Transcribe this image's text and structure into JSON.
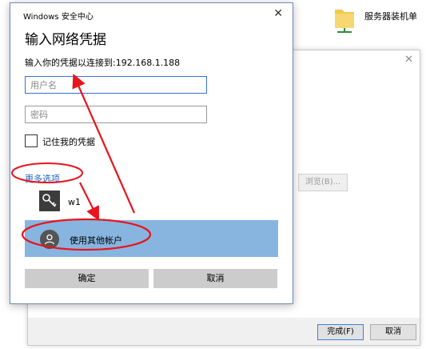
{
  "background": {
    "folder_label": "服务器装机单",
    "browse_label": "浏览(B)...",
    "finish_label": "完成(F)",
    "cancel_label": "取消",
    "close_glyph": "✕"
  },
  "dialog": {
    "caption": "Windows 安全中心",
    "close_glyph": "✕",
    "heading": "输入网络凭据",
    "prompt": "输入你的凭据以连接到:192.168.1.188",
    "username_placeholder": "用户名",
    "password_placeholder": "密码",
    "remember_label": "记住我的凭据",
    "more_options": "更多选项",
    "accounts": [
      {
        "label": "w1",
        "icon": "key-icon"
      },
      {
        "label": "使用其他帐户",
        "icon": "person-icon",
        "selected": true
      }
    ],
    "ok_label": "确定",
    "cancel_label": "取消"
  },
  "colors": {
    "selected_row": "#87b5e0",
    "link": "#1a62c9",
    "annotation": "#e8141c"
  }
}
